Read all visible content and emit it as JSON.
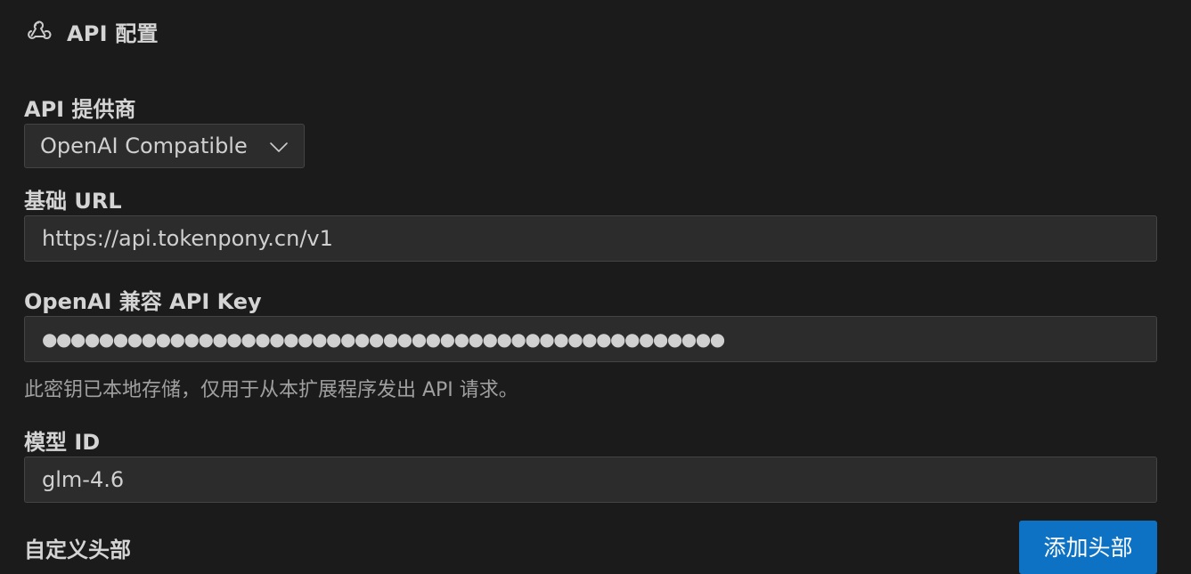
{
  "section": {
    "title": "API 配置",
    "icon": "webhook-icon"
  },
  "provider": {
    "label": "API 提供商",
    "selected": "OpenAI Compatible",
    "icon": "chevron-down-icon"
  },
  "base_url": {
    "label": "基础 URL",
    "value": "https://api.tokenpony.cn/v1"
  },
  "api_key": {
    "label": "OpenAI 兼容 API Key",
    "value": "●●●●●●●●●●●●●●●●●●●●●●●●●●●●●●●●●●●●●●●●●●●●●●●●",
    "help": "此密钥已本地存储，仅用于从本扩展程序发出 API 请求。"
  },
  "model": {
    "label": "模型 ID",
    "value": "glm-4.6"
  },
  "custom_headers": {
    "label": "自定义头部",
    "add_button": "添加头部"
  },
  "colors": {
    "background": "#1b1b1b",
    "input_background": "#2c2c2c",
    "border": "#444444",
    "button": "#0e72c4",
    "text": "#cccccc"
  }
}
